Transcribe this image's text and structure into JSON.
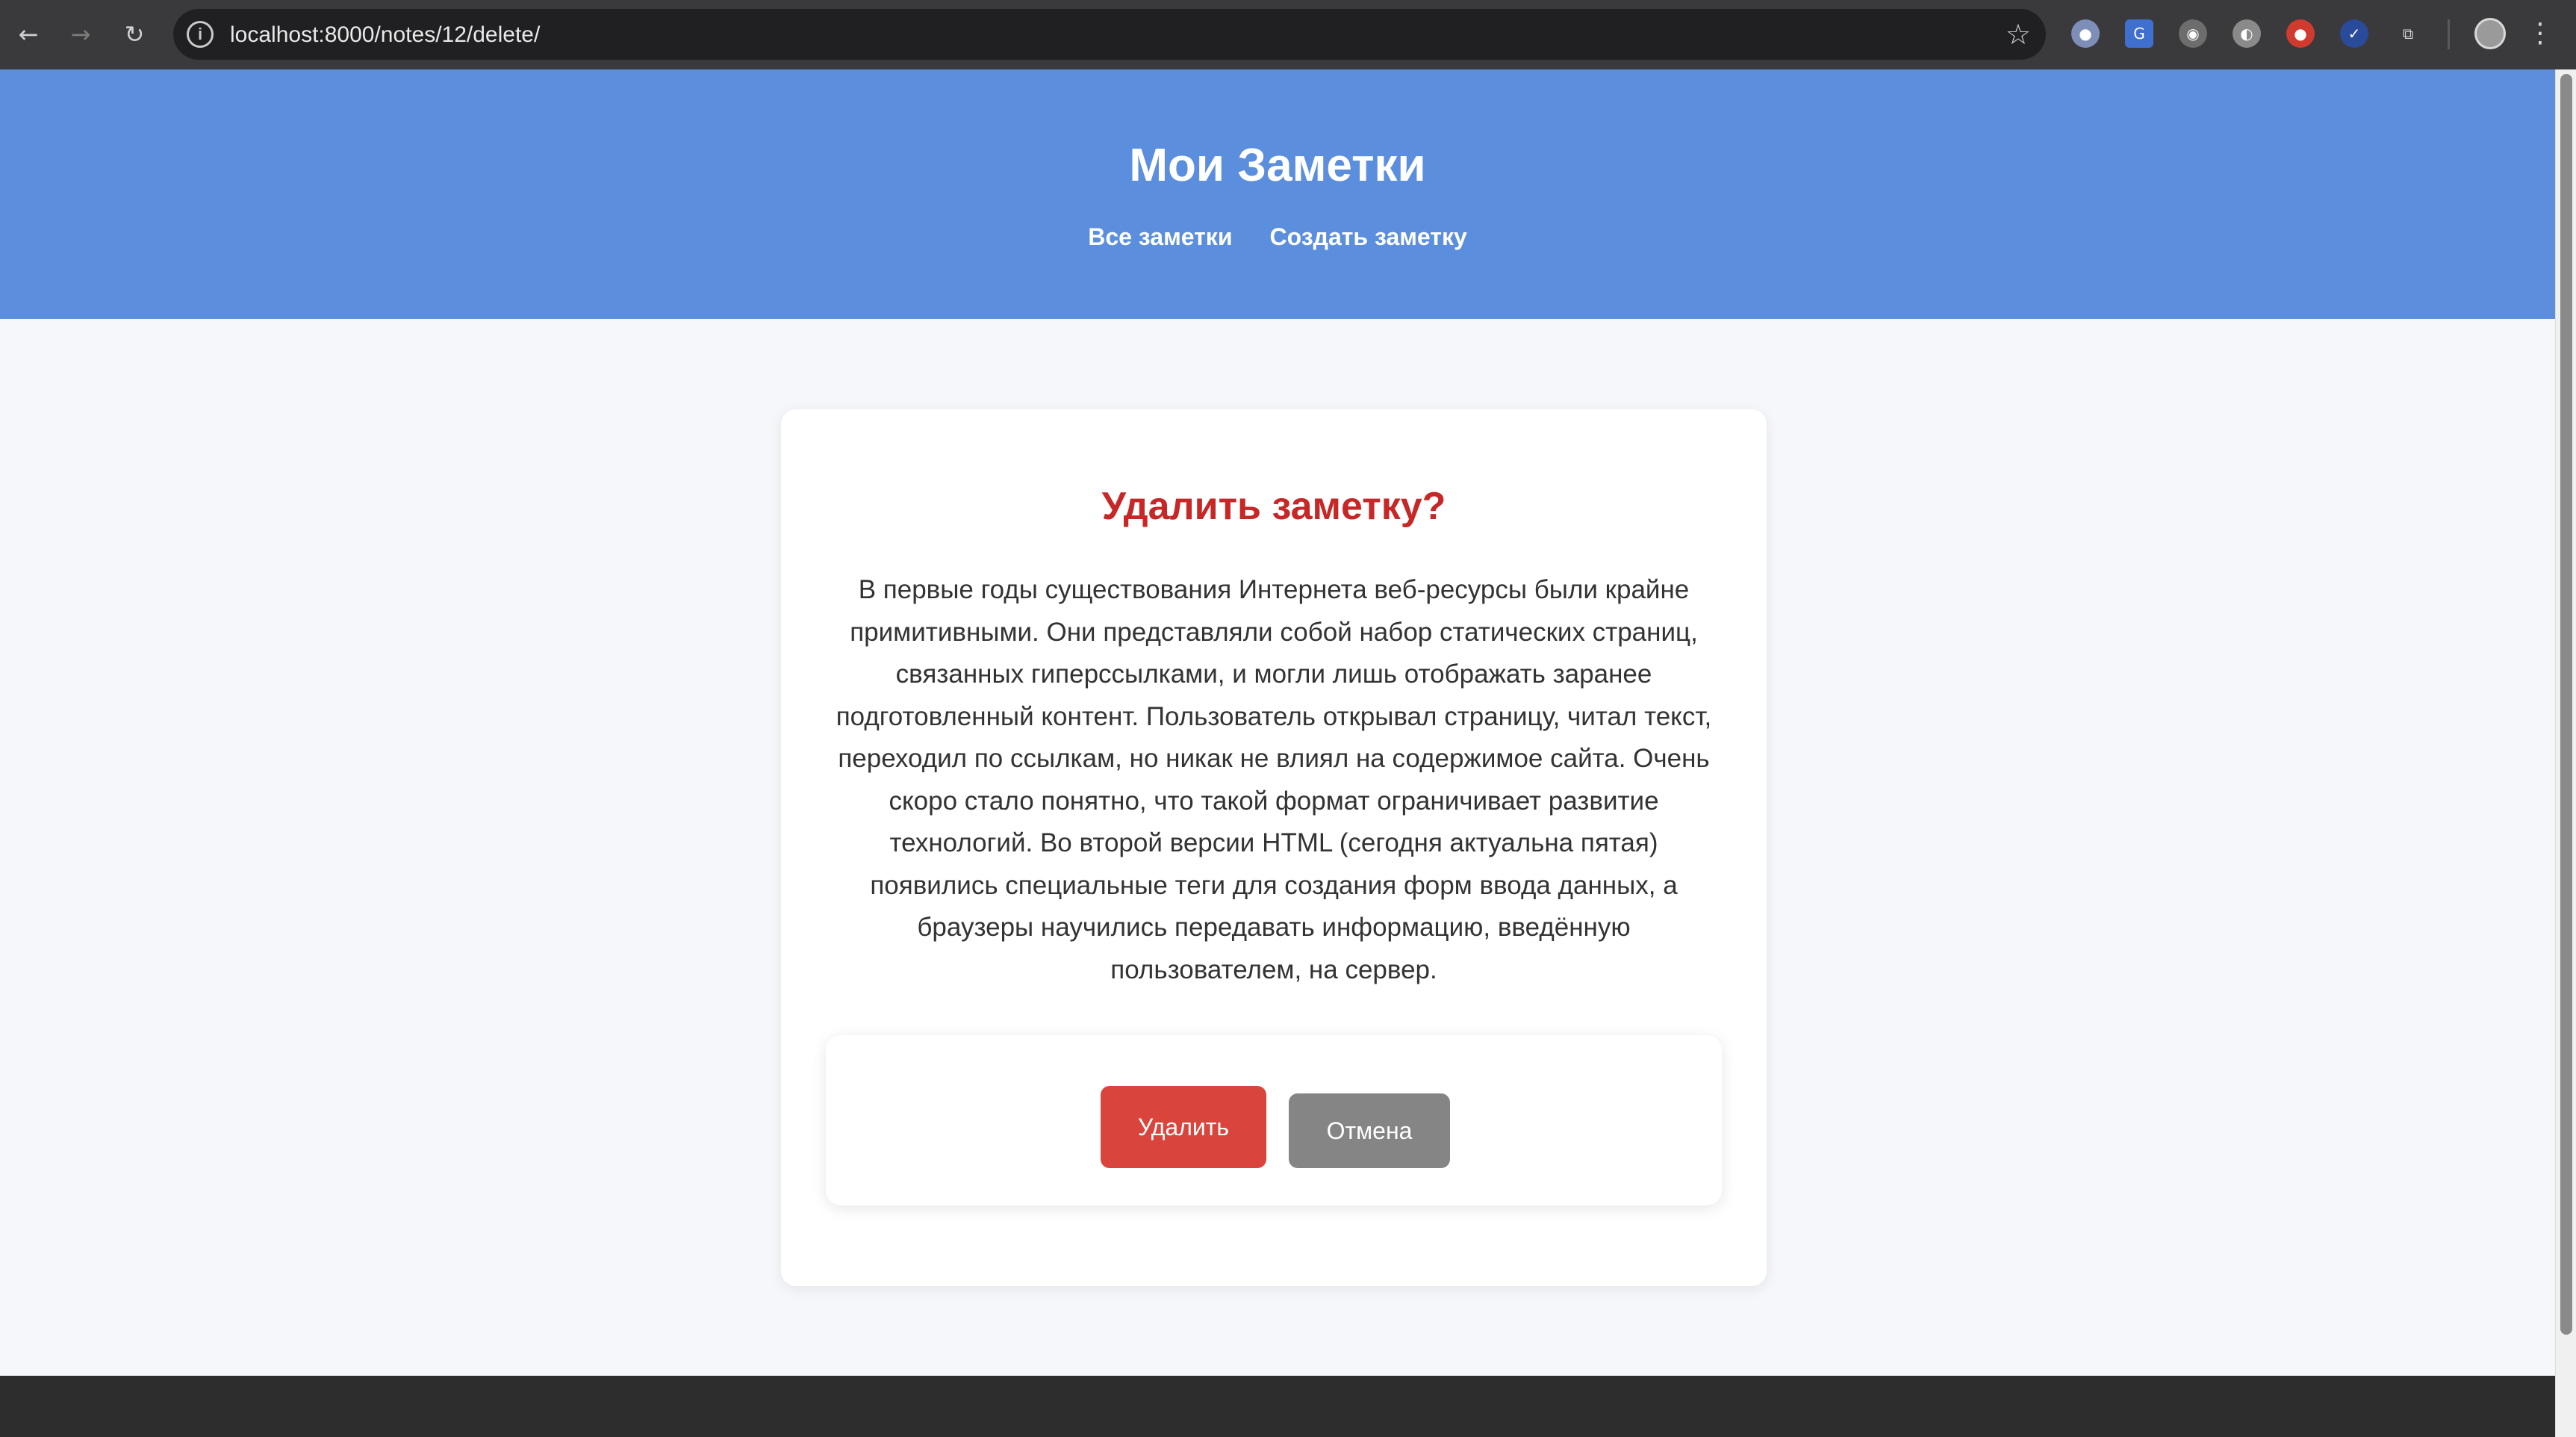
{
  "browser": {
    "url": "localhost:8000/notes/12/delete/",
    "icons": [
      "back-arrow-icon",
      "forward-arrow-icon",
      "reload-icon",
      "site-info-icon",
      "bookmark-star-icon",
      "extensions-icon",
      "profile-avatar",
      "menu-icon"
    ]
  },
  "header": {
    "title": "Мои Заметки",
    "nav": [
      {
        "label": "Все заметки"
      },
      {
        "label": "Создать заметку"
      }
    ]
  },
  "confirm": {
    "title": "Удалить заметку?",
    "text": "В первые годы существования Интернета веб-ресурсы были крайне примитивными. Они представляли собой набор статических страниц, связанных гиперссылками, и могли лишь отображать заранее подготовленный контент. Пользователь открывал страницу, читал текст, переходил по ссылкам, но никак не влиял на содержимое сайта. Очень скоро стало понятно, что такой формат ограничивает развитие технологий. Во второй версии HTML (сегодня актуальна пятая) появились специальные теги для создания форм ввода данных, а браузеры научились передавать информацию, введённую пользователем, на сервер.",
    "delete_label": "Удалить",
    "cancel_label": "Отмена"
  },
  "colors": {
    "header_bg": "#5b8fdd",
    "title_red": "#c62828",
    "delete_btn": "#d9453d",
    "cancel_btn": "#858585"
  }
}
